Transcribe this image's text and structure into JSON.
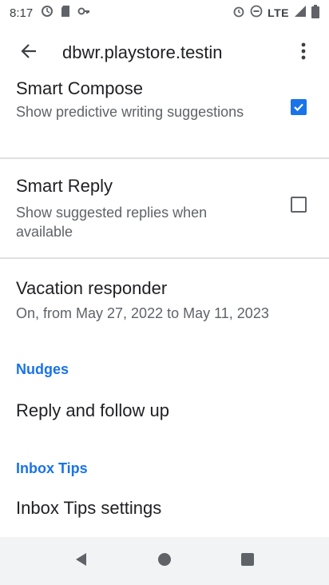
{
  "status_bar": {
    "time": "8:17",
    "network": "LTE",
    "left_icons": [
      "sync-icon",
      "sd-card-icon",
      "vpn-icon"
    ],
    "right_icons": [
      "alarm-icon",
      "do-not-disturb-icon",
      "signal-icon",
      "battery-icon"
    ]
  },
  "app_bar": {
    "title": "dbwr.playstore.testin",
    "back_icon": "back-arrow-icon",
    "overflow_icon": "more-vert-icon"
  },
  "settings": {
    "smart_compose": {
      "title": "Smart Compose",
      "summary": "Show predictive writing suggestions",
      "checked": true
    },
    "smart_reply": {
      "title": "Smart Reply",
      "summary": "Show suggested replies when available",
      "checked": false
    },
    "vacation_responder": {
      "title": "Vacation responder",
      "summary": "On, from May 27, 2022 to May 11, 2023"
    },
    "nudges_header": "Nudges",
    "reply_follow_up": {
      "title": "Reply and follow up"
    },
    "inbox_tips_header": "Inbox Tips",
    "inbox_tips_settings": {
      "title": "Inbox Tips settings"
    }
  },
  "nav_bar": {
    "icons": [
      "nav-back-icon",
      "nav-home-icon",
      "nav-recents-icon"
    ]
  },
  "colors": {
    "accent": "#1a73e8",
    "text_primary": "#202124",
    "text_secondary": "#5f6368",
    "nav_bg": "#f1f3f4"
  }
}
